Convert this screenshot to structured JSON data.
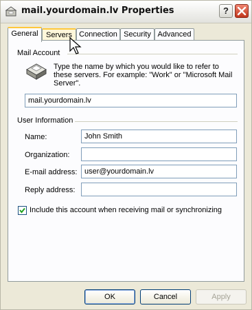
{
  "window": {
    "title": "mail.yourdomain.lv Properties",
    "help_label": "?"
  },
  "tabs": [
    {
      "label": "General",
      "selected": true
    },
    {
      "label": "Servers",
      "hover": true
    },
    {
      "label": "Connection"
    },
    {
      "label": "Security"
    },
    {
      "label": "Advanced"
    }
  ],
  "mail_account": {
    "group_label": "Mail Account",
    "description": "Type the name by which you would like to refer to these servers.  For example: \"Work\" or \"Microsoft Mail Server\".",
    "account_name": "mail.yourdomain.lv"
  },
  "user_info": {
    "group_label": "User Information",
    "name_label": "Name:",
    "name_value": "John Smith",
    "org_label": "Organization:",
    "org_value": "",
    "email_label": "E-mail address:",
    "email_value": "user@yourdomain.lv",
    "reply_label": "Reply address:",
    "reply_value": ""
  },
  "include_checkbox": {
    "label": "Include this account when receiving mail or synchronizing",
    "checked": true
  },
  "buttons": {
    "ok": "OK",
    "cancel": "Cancel",
    "apply": "Apply"
  },
  "colors": {
    "tab_highlight": "#ffc83c",
    "close_button": "#c0351b",
    "dialog_bg": "#ece9d8"
  }
}
